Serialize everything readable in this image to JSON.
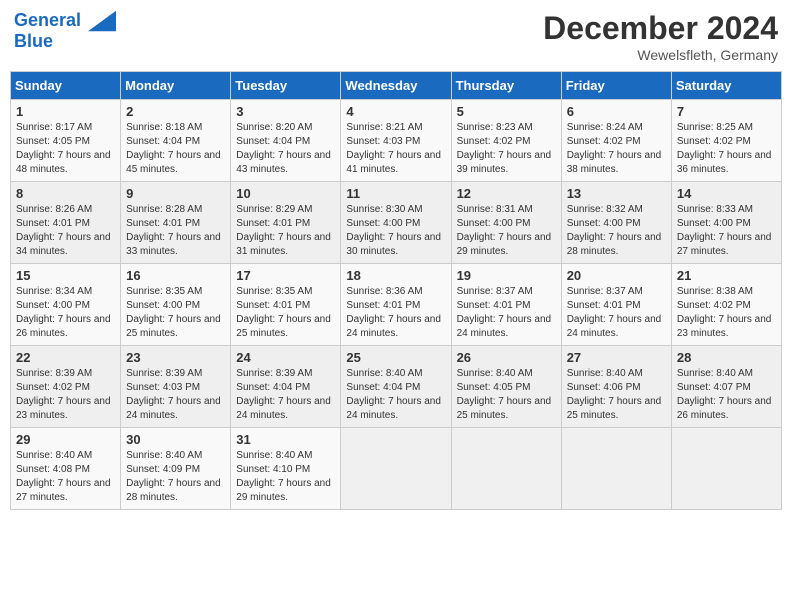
{
  "header": {
    "logo_line1": "General",
    "logo_line2": "Blue",
    "month": "December 2024",
    "location": "Wewelsfleth, Germany"
  },
  "days_of_week": [
    "Sunday",
    "Monday",
    "Tuesday",
    "Wednesday",
    "Thursday",
    "Friday",
    "Saturday"
  ],
  "weeks": [
    [
      {
        "day": "1",
        "sunrise": "8:17 AM",
        "sunset": "4:05 PM",
        "daylight": "7 hours and 48 minutes."
      },
      {
        "day": "2",
        "sunrise": "8:18 AM",
        "sunset": "4:04 PM",
        "daylight": "7 hours and 45 minutes."
      },
      {
        "day": "3",
        "sunrise": "8:20 AM",
        "sunset": "4:04 PM",
        "daylight": "7 hours and 43 minutes."
      },
      {
        "day": "4",
        "sunrise": "8:21 AM",
        "sunset": "4:03 PM",
        "daylight": "7 hours and 41 minutes."
      },
      {
        "day": "5",
        "sunrise": "8:23 AM",
        "sunset": "4:02 PM",
        "daylight": "7 hours and 39 minutes."
      },
      {
        "day": "6",
        "sunrise": "8:24 AM",
        "sunset": "4:02 PM",
        "daylight": "7 hours and 38 minutes."
      },
      {
        "day": "7",
        "sunrise": "8:25 AM",
        "sunset": "4:02 PM",
        "daylight": "7 hours and 36 minutes."
      }
    ],
    [
      {
        "day": "8",
        "sunrise": "8:26 AM",
        "sunset": "4:01 PM",
        "daylight": "7 hours and 34 minutes."
      },
      {
        "day": "9",
        "sunrise": "8:28 AM",
        "sunset": "4:01 PM",
        "daylight": "7 hours and 33 minutes."
      },
      {
        "day": "10",
        "sunrise": "8:29 AM",
        "sunset": "4:01 PM",
        "daylight": "7 hours and 31 minutes."
      },
      {
        "day": "11",
        "sunrise": "8:30 AM",
        "sunset": "4:00 PM",
        "daylight": "7 hours and 30 minutes."
      },
      {
        "day": "12",
        "sunrise": "8:31 AM",
        "sunset": "4:00 PM",
        "daylight": "7 hours and 29 minutes."
      },
      {
        "day": "13",
        "sunrise": "8:32 AM",
        "sunset": "4:00 PM",
        "daylight": "7 hours and 28 minutes."
      },
      {
        "day": "14",
        "sunrise": "8:33 AM",
        "sunset": "4:00 PM",
        "daylight": "7 hours and 27 minutes."
      }
    ],
    [
      {
        "day": "15",
        "sunrise": "8:34 AM",
        "sunset": "4:00 PM",
        "daylight": "7 hours and 26 minutes."
      },
      {
        "day": "16",
        "sunrise": "8:35 AM",
        "sunset": "4:00 PM",
        "daylight": "7 hours and 25 minutes."
      },
      {
        "day": "17",
        "sunrise": "8:35 AM",
        "sunset": "4:01 PM",
        "daylight": "7 hours and 25 minutes."
      },
      {
        "day": "18",
        "sunrise": "8:36 AM",
        "sunset": "4:01 PM",
        "daylight": "7 hours and 24 minutes."
      },
      {
        "day": "19",
        "sunrise": "8:37 AM",
        "sunset": "4:01 PM",
        "daylight": "7 hours and 24 minutes."
      },
      {
        "day": "20",
        "sunrise": "8:37 AM",
        "sunset": "4:01 PM",
        "daylight": "7 hours and 24 minutes."
      },
      {
        "day": "21",
        "sunrise": "8:38 AM",
        "sunset": "4:02 PM",
        "daylight": "7 hours and 23 minutes."
      }
    ],
    [
      {
        "day": "22",
        "sunrise": "8:39 AM",
        "sunset": "4:02 PM",
        "daylight": "7 hours and 23 minutes."
      },
      {
        "day": "23",
        "sunrise": "8:39 AM",
        "sunset": "4:03 PM",
        "daylight": "7 hours and 24 minutes."
      },
      {
        "day": "24",
        "sunrise": "8:39 AM",
        "sunset": "4:04 PM",
        "daylight": "7 hours and 24 minutes."
      },
      {
        "day": "25",
        "sunrise": "8:40 AM",
        "sunset": "4:04 PM",
        "daylight": "7 hours and 24 minutes."
      },
      {
        "day": "26",
        "sunrise": "8:40 AM",
        "sunset": "4:05 PM",
        "daylight": "7 hours and 25 minutes."
      },
      {
        "day": "27",
        "sunrise": "8:40 AM",
        "sunset": "4:06 PM",
        "daylight": "7 hours and 25 minutes."
      },
      {
        "day": "28",
        "sunrise": "8:40 AM",
        "sunset": "4:07 PM",
        "daylight": "7 hours and 26 minutes."
      }
    ],
    [
      {
        "day": "29",
        "sunrise": "8:40 AM",
        "sunset": "4:08 PM",
        "daylight": "7 hours and 27 minutes."
      },
      {
        "day": "30",
        "sunrise": "8:40 AM",
        "sunset": "4:09 PM",
        "daylight": "7 hours and 28 minutes."
      },
      {
        "day": "31",
        "sunrise": "8:40 AM",
        "sunset": "4:10 PM",
        "daylight": "7 hours and 29 minutes."
      },
      null,
      null,
      null,
      null
    ]
  ]
}
